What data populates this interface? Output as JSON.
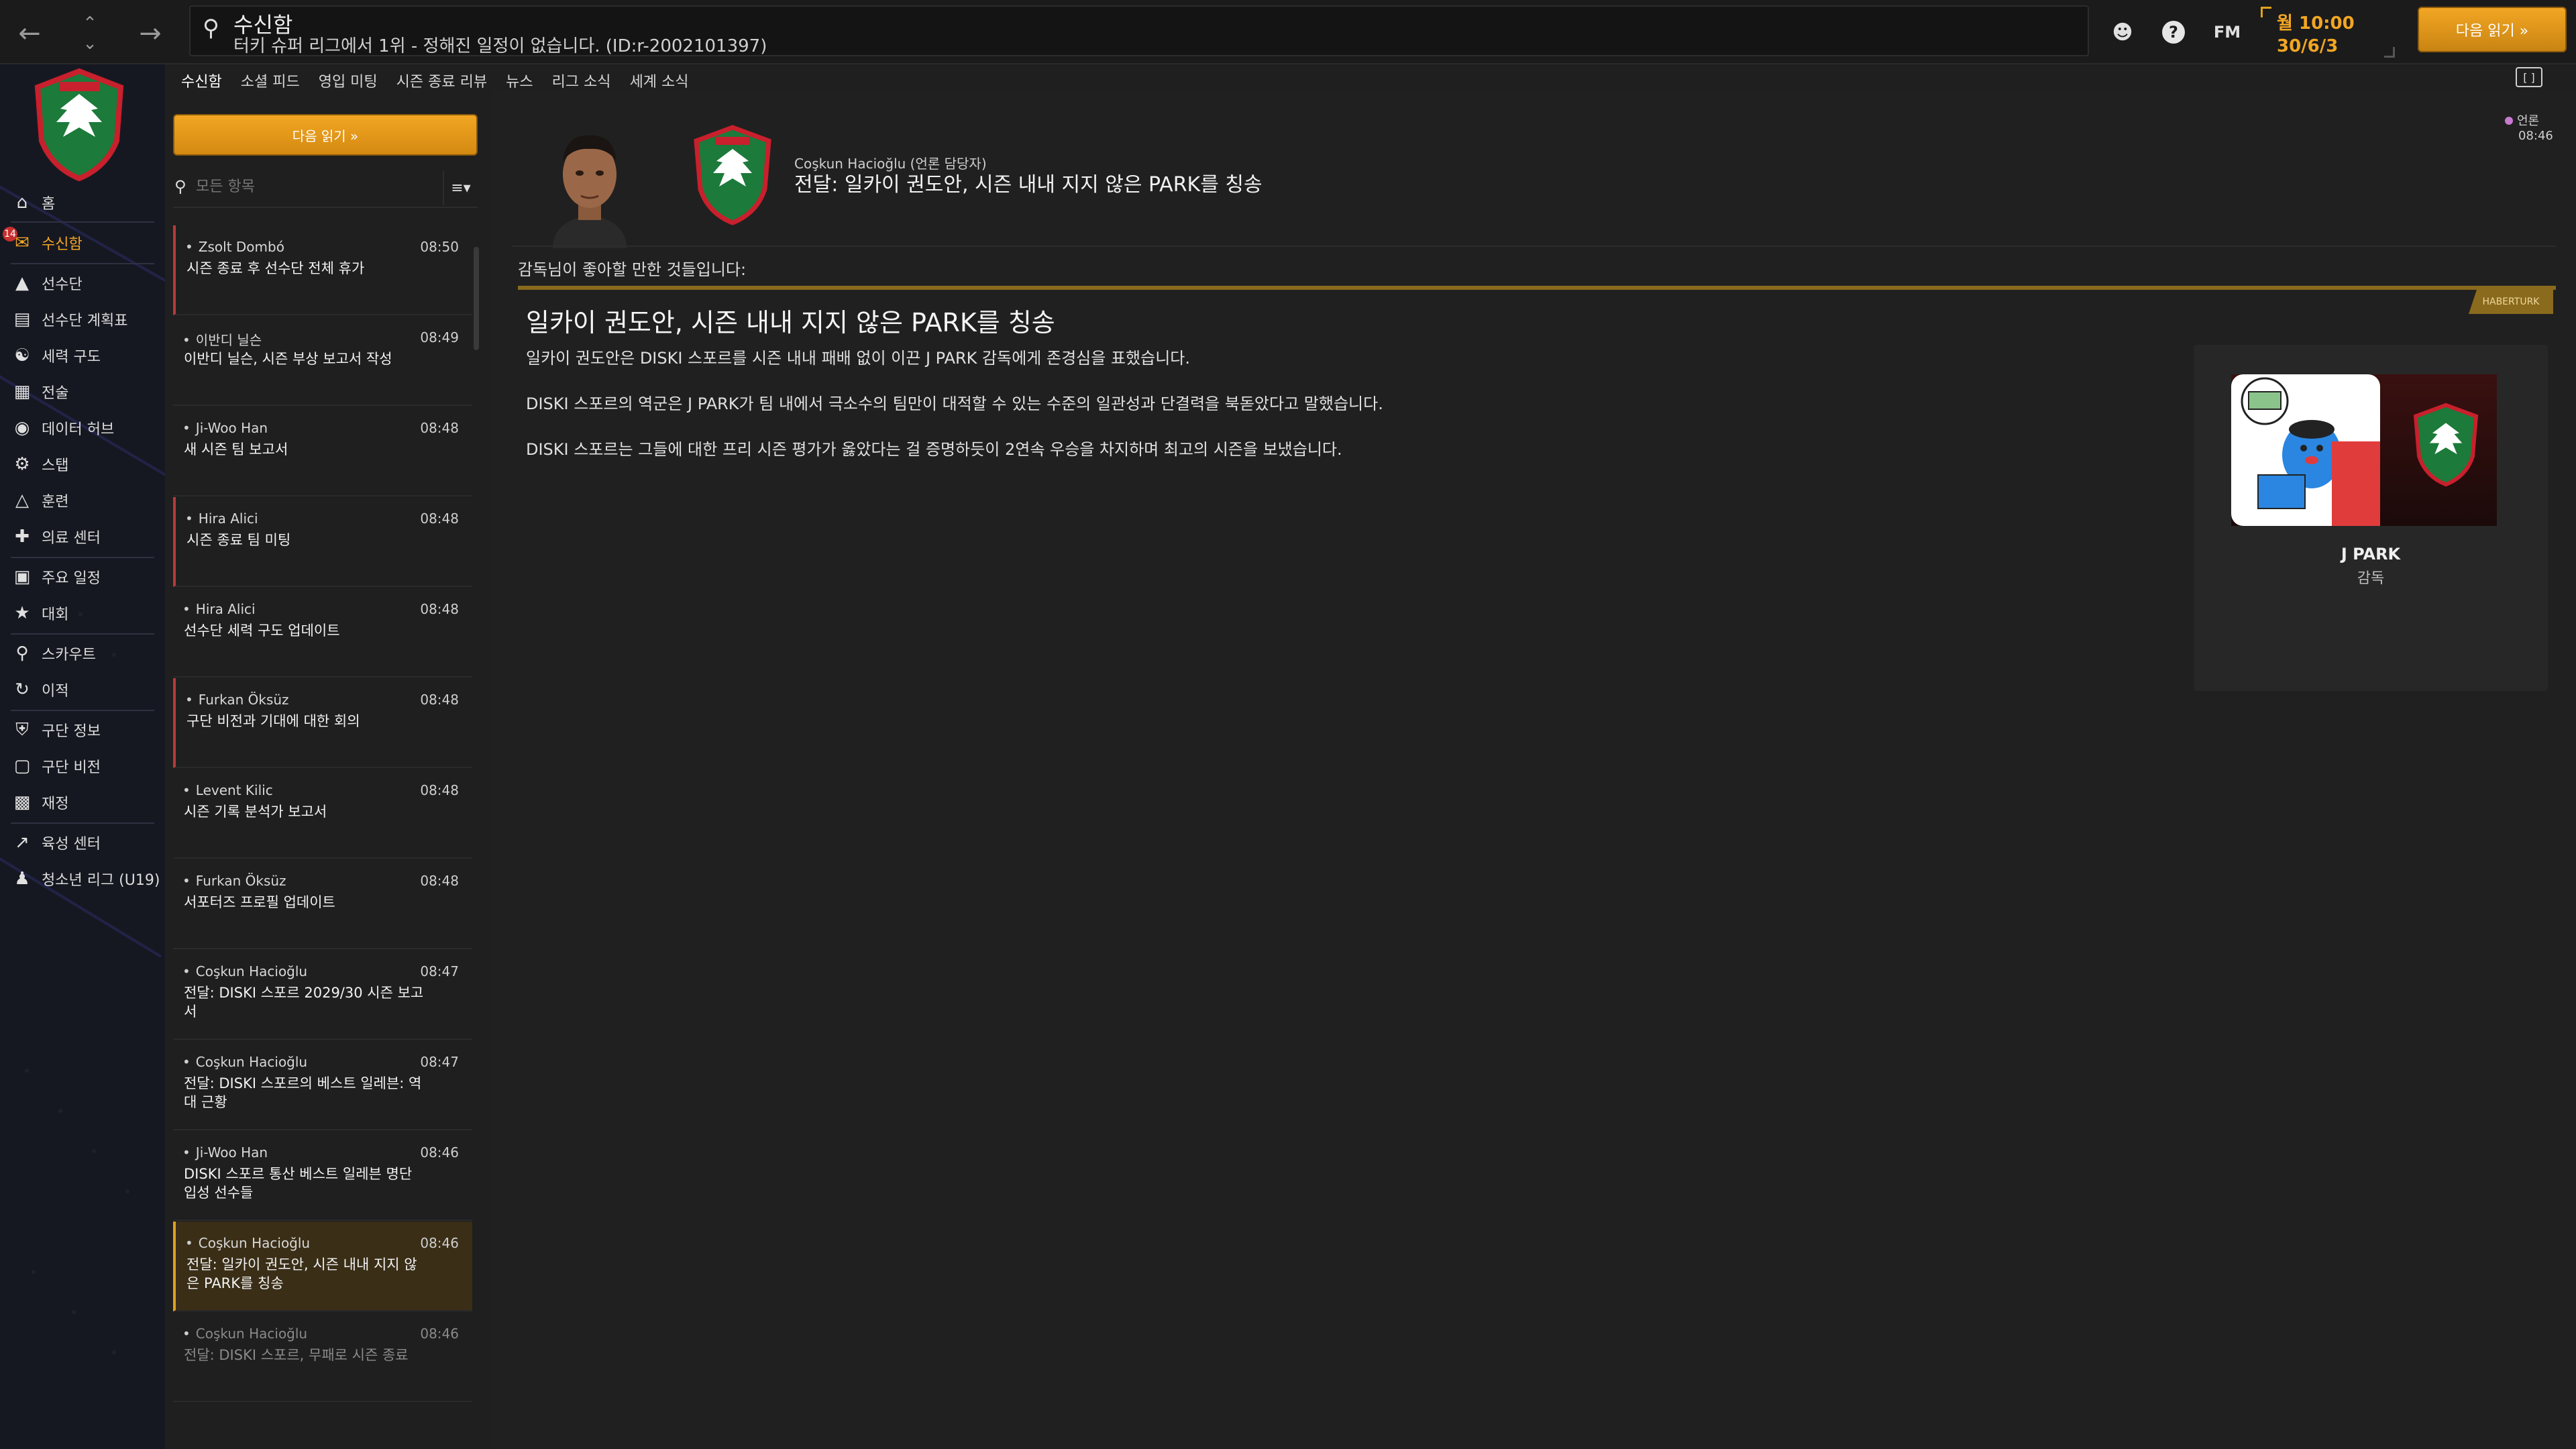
{
  "topbar": {
    "back_icon": "arrow-left-icon",
    "forward_icon": "arrow-right-icon",
    "search_title": "수신함",
    "search_subtitle": "터키 슈퍼 리그에서 1위 - 정해진 일정이 없습니다. (ID:r-2002101397)",
    "fm_label": "FM",
    "time": "월 10:00",
    "date": "30/6/3",
    "continue_label": "다음 읽기 »"
  },
  "sidebar": {
    "items": [
      {
        "label": "홈",
        "icon": "home-icon"
      },
      {
        "label": "수신함",
        "icon": "inbox-icon",
        "badge": "14"
      },
      {
        "label": "선수단",
        "icon": "shirt-icon"
      },
      {
        "label": "선수단 계획표",
        "icon": "clipboard-icon"
      },
      {
        "label": "세력 구도",
        "icon": "hierarchy-icon"
      },
      {
        "label": "전술",
        "icon": "tactics-icon"
      },
      {
        "label": "데이터 허브",
        "icon": "data-hub-icon"
      },
      {
        "label": "스탭",
        "icon": "staff-icon"
      },
      {
        "label": "훈련",
        "icon": "training-icon"
      },
      {
        "label": "의료 센터",
        "icon": "medical-icon"
      },
      {
        "label": "주요 일정",
        "icon": "calendar-icon"
      },
      {
        "label": "대회",
        "icon": "trophy-icon"
      },
      {
        "label": "스카우트",
        "icon": "scout-icon"
      },
      {
        "label": "이적",
        "icon": "transfer-icon"
      },
      {
        "label": "구단 정보",
        "icon": "club-info-icon"
      },
      {
        "label": "구단 비전",
        "icon": "club-vision-icon"
      },
      {
        "label": "재정",
        "icon": "finance-icon"
      },
      {
        "label": "육성 센터",
        "icon": "development-icon"
      },
      {
        "label": "청소년 리그 (U19)",
        "icon": "youth-icon"
      }
    ]
  },
  "tabs": [
    "수신함",
    "소셜 피드",
    "영입 미팅",
    "시즌 종료 리뷰",
    "뉴스",
    "리그 소식",
    "세계 소식"
  ],
  "inbox": {
    "read_next": "다음 읽기 »",
    "filter_placeholder": "모든 항목",
    "messages": [
      {
        "sender": "Zsolt Dombó",
        "time": "08:50",
        "subject": "시즌 종료 후 선수단 전체 휴가"
      },
      {
        "sender": "이반디 닐슨",
        "time": "08:49",
        "subject": "이반디 닐슨, 시즌 부상 보고서 작성"
      },
      {
        "sender": "Ji-Woo Han",
        "time": "08:48",
        "subject": "새 시즌 팀 보고서"
      },
      {
        "sender": "Hira Alici",
        "time": "08:48",
        "subject": "시즌 종료 팀 미팅"
      },
      {
        "sender": "Hira Alici",
        "time": "08:48",
        "subject": "선수단 세력 구도 업데이트"
      },
      {
        "sender": "Furkan Öksüz",
        "time": "08:48",
        "subject": "구단 비전과 기대에 대한 회의"
      },
      {
        "sender": "Levent Kilic",
        "time": "08:48",
        "subject": "시즌 기록 분석가 보고서"
      },
      {
        "sender": "Furkan Öksüz",
        "time": "08:48",
        "subject": "서포터즈 프로필 업데이트"
      },
      {
        "sender": "Coşkun Hacioğlu",
        "time": "08:47",
        "subject": "전달: DISKI 스포르 2029/30 시즌 보고서"
      },
      {
        "sender": "Coşkun Hacioğlu",
        "time": "08:47",
        "subject": "전달: DISKI 스포르의 베스트 일레븐: 역대 근황"
      },
      {
        "sender": "Ji-Woo Han",
        "time": "08:46",
        "subject": "DISKI 스포르 통산 베스트 일레븐 명단 입성 선수들"
      },
      {
        "sender": "Coşkun Hacioğlu",
        "time": "08:46",
        "subject": "전달: 일카이 권도안, 시즌 내내 지지 않은 PARK를 칭송"
      },
      {
        "sender": "Coşkun Hacioğlu",
        "time": "08:46",
        "subject": "전달: DISKI 스포르, 무패로 시즌 종료"
      }
    ]
  },
  "main": {
    "sender_line": "Coşkun Hacioğlu (언론 담당자)",
    "headline": "전달: 일카이 권도안, 시즌 내내 지지 않은 PARK를 칭송",
    "news_badge": "언론",
    "news_time": "08:46",
    "intro": "감독님이 좋아할 만한 것들입니다:",
    "source": "HABERTURK",
    "article_title": "일카이 권도안, 시즌 내내 지지 않은 PARK를 칭송",
    "paragraphs": [
      "일카이 권도안은 DISKI 스포르를 시즌 내내 패배 없이 이끈 J PARK 감독에게 존경심을 표했습니다.",
      "DISKI 스포르의 역군은 J PARK가 팀 내에서 극소수의 팀만이 대적할 수 있는 수준의 일관성과 단결력을 북돋았다고 말했습니다.",
      "DISKI 스포르는 그들에 대한 프리 시즌 평가가 옳았다는 걸 증명하듯이 2연속 우승을 차지하며 최고의 시즌을 보냈습니다."
    ],
    "card_name": "J PARK",
    "card_role": "감독"
  },
  "colors": {
    "accent": "#f2a623",
    "selected_bg": "#3a2e17",
    "flag": "#b83a3a",
    "sidebar_bg": "#161821"
  }
}
